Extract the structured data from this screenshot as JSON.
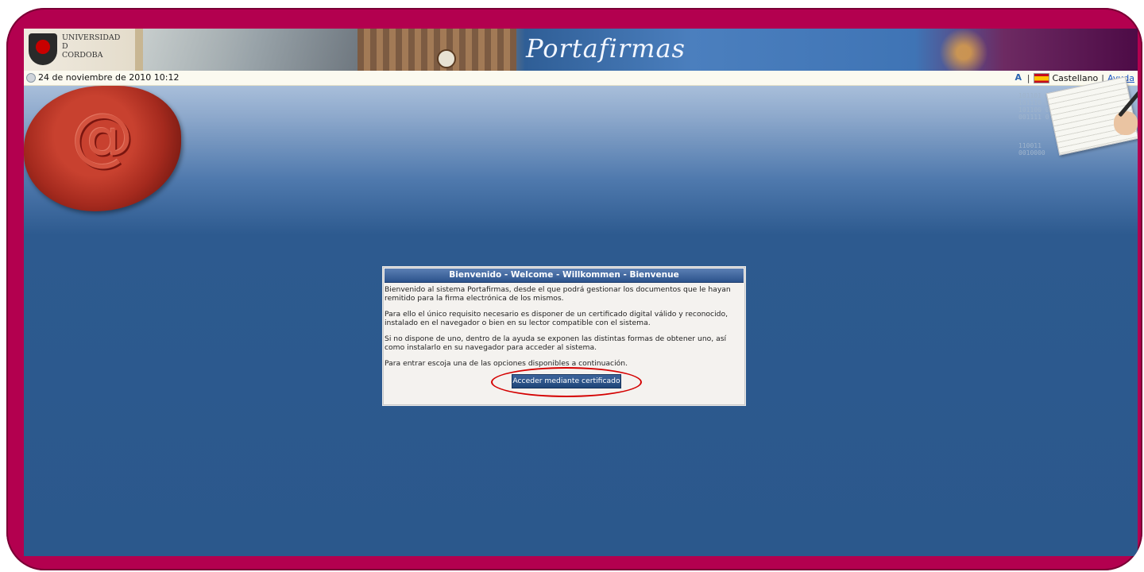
{
  "header": {
    "institution_name": "UNIVERSIDAD\nD\nCORDOBA",
    "app_title": "Portafirmas"
  },
  "infobar": {
    "datetime": "24 de noviembre de 2010  10:12",
    "language": "Castellano",
    "help_link": "Ayuda",
    "separator": "|"
  },
  "decor": {
    "seal_symbol": "@",
    "binary_text": "101101 0\n101110 0\n101100 0\n001111 0\n\n\n\n110011\n0010000"
  },
  "dialog": {
    "title": "Bienvenido - Welcome - Willkommen - Bienvenue",
    "paragraphs": [
      "Bienvenido al sistema Portafirmas, desde el que podrá gestionar los documentos que le hayan remitido para la firma electrónica de los mismos.",
      "Para ello el único requisito necesario es disponer de un certificado digital válido y reconocido, instalado en el navegador o bien en su lector compatible con el sistema.",
      "Si no dispone de uno, dentro de la ayuda se exponen las distintas formas de obtener uno, así como instalarlo en su navegador para acceder al sistema.",
      "Para entrar escoja una de las opciones disponibles a continuación."
    ],
    "button_label": "Acceder mediante certificado"
  },
  "colors": {
    "frame": "#b3004f",
    "background": "#2b588c",
    "dialog_header": "#2c538c",
    "highlight": "#d40000"
  },
  "icons": [
    "clock-icon",
    "language-icon",
    "spanish-flag-icon",
    "wax-seal-icon",
    "university-crest-icon"
  ]
}
